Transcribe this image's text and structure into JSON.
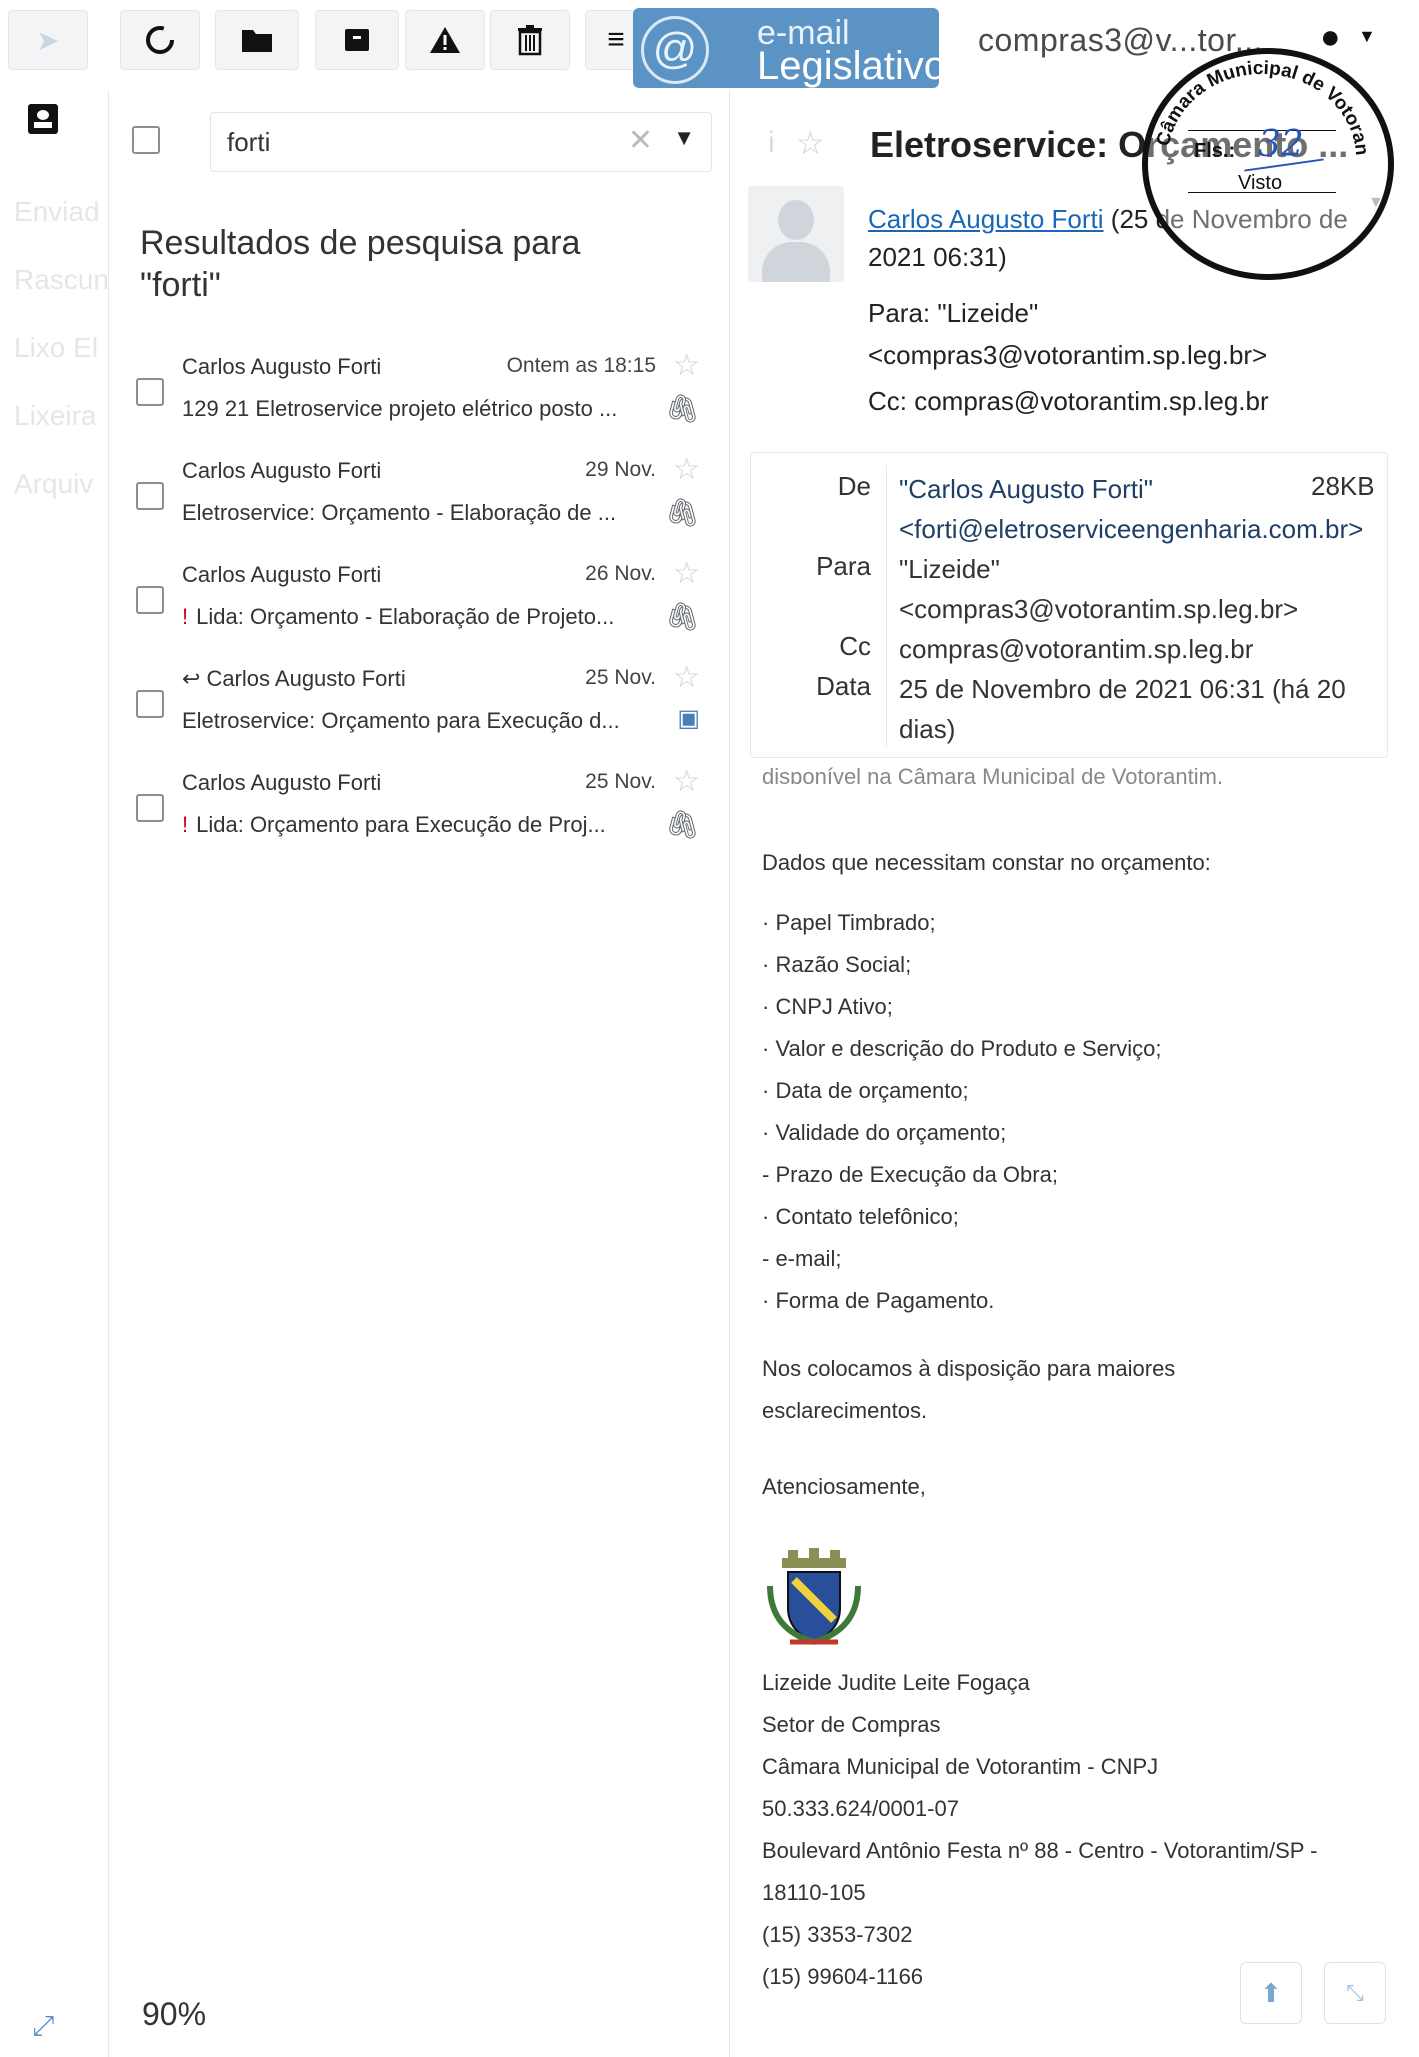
{
  "toolbar": {
    "account": "compras3@v...tor...",
    "logo_line1": "e-mail",
    "logo_line2": "Legislativo"
  },
  "nav": {
    "items": [
      "Enviad",
      "Rascun",
      "Lixo El",
      "Lixeira",
      "Arquiv"
    ]
  },
  "search": {
    "query": "forti"
  },
  "results_title": "Resultados de pesquisa para \"forti\"",
  "messages": [
    {
      "sender": "Carlos Augusto Forti",
      "date": "Ontem as 18:15",
      "subject": "129 21 Eletroservice projeto elétrico posto ...",
      "flag": "",
      "icon": "attachment"
    },
    {
      "sender": "Carlos Augusto Forti",
      "date": "29 Nov.",
      "subject": "Eletroservice: Orçamento - Elaboração de ...",
      "flag": "",
      "icon": "attachment"
    },
    {
      "sender": "Carlos Augusto Forti",
      "date": "26 Nov.",
      "subject": "Lida: Orçamento - Elaboração de Projeto...",
      "flag": "!",
      "icon": "attachment"
    },
    {
      "sender": "Carlos Augusto Forti",
      "date": "25 Nov.",
      "subject": "Eletroservice: Orçamento para Execução d...",
      "flag": "",
      "icon": "image"
    },
    {
      "sender": "Carlos Augusto Forti",
      "date": "25 Nov.",
      "subject": "Lida: Orçamento para Execução de Proj...",
      "flag": "!",
      "icon": "attachment"
    }
  ],
  "zoom": "90%",
  "message": {
    "title": "Eletroservice: Orçamento ...",
    "from_name": "Carlos Augusto Forti",
    "from_date": "(25 de Novembro de 2021 06:31)",
    "to": "Para: \"Lizeide\" <compras3@votorantim.sp.leg.br>",
    "cc": "Cc: compras@votorantim.sp.leg.br",
    "headers": {
      "de_label": "De",
      "de_value": "\"Carlos Augusto Forti\" <forti@eletroserviceengenharia.com.br>",
      "size": "28KB",
      "para_label": "Para",
      "para_value": "\"Lizeide\" <compras3@votorantim.sp.leg.br>",
      "cc_label": "Cc",
      "cc_value": "compras@votorantim.sp.leg.br",
      "data_label": "Data",
      "data_value": "25 de Novembro de 2021 06:31 (há 20 dias)"
    },
    "cut_line": "disponível na Câmara Municipal de Votorantim.",
    "intro": "Dados que necessitam constar no orçamento:",
    "bullets": [
      "· Papel Timbrado;",
      "· Razão Social;",
      "· CNPJ Ativo;",
      "· Valor e descrição do Produto e Serviço;",
      "· Data de orçamento;",
      "· Validade do orçamento;",
      "- Prazo de Execução da Obra;",
      "· Contato telefônico;",
      "- e-mail;",
      "· Forma de Pagamento."
    ],
    "closing": "Nos colocamos à disposição para maiores esclarecimentos.",
    "regards": "Atenciosamente,",
    "signature": [
      "Lizeide Judite Leite Fogaça",
      "Setor de Compras",
      "Câmara Municipal de Votorantim - CNPJ",
      "50.333.624/0001-07",
      "Boulevard Antônio Festa nº 88 - Centro - Votorantim/SP -",
      "18110-105",
      "(15) 3353-7302",
      "(15) 99604-1166"
    ]
  },
  "stamp": {
    "ring_text": "Câmara Municipal de Votorantim",
    "fls_label": "Fls.:",
    "fls_number": "32",
    "visto": "Visto"
  },
  "colors": {
    "logo_bg": "#5c93c5",
    "link": "#1a66b8",
    "flag_red": "#d0021b"
  }
}
